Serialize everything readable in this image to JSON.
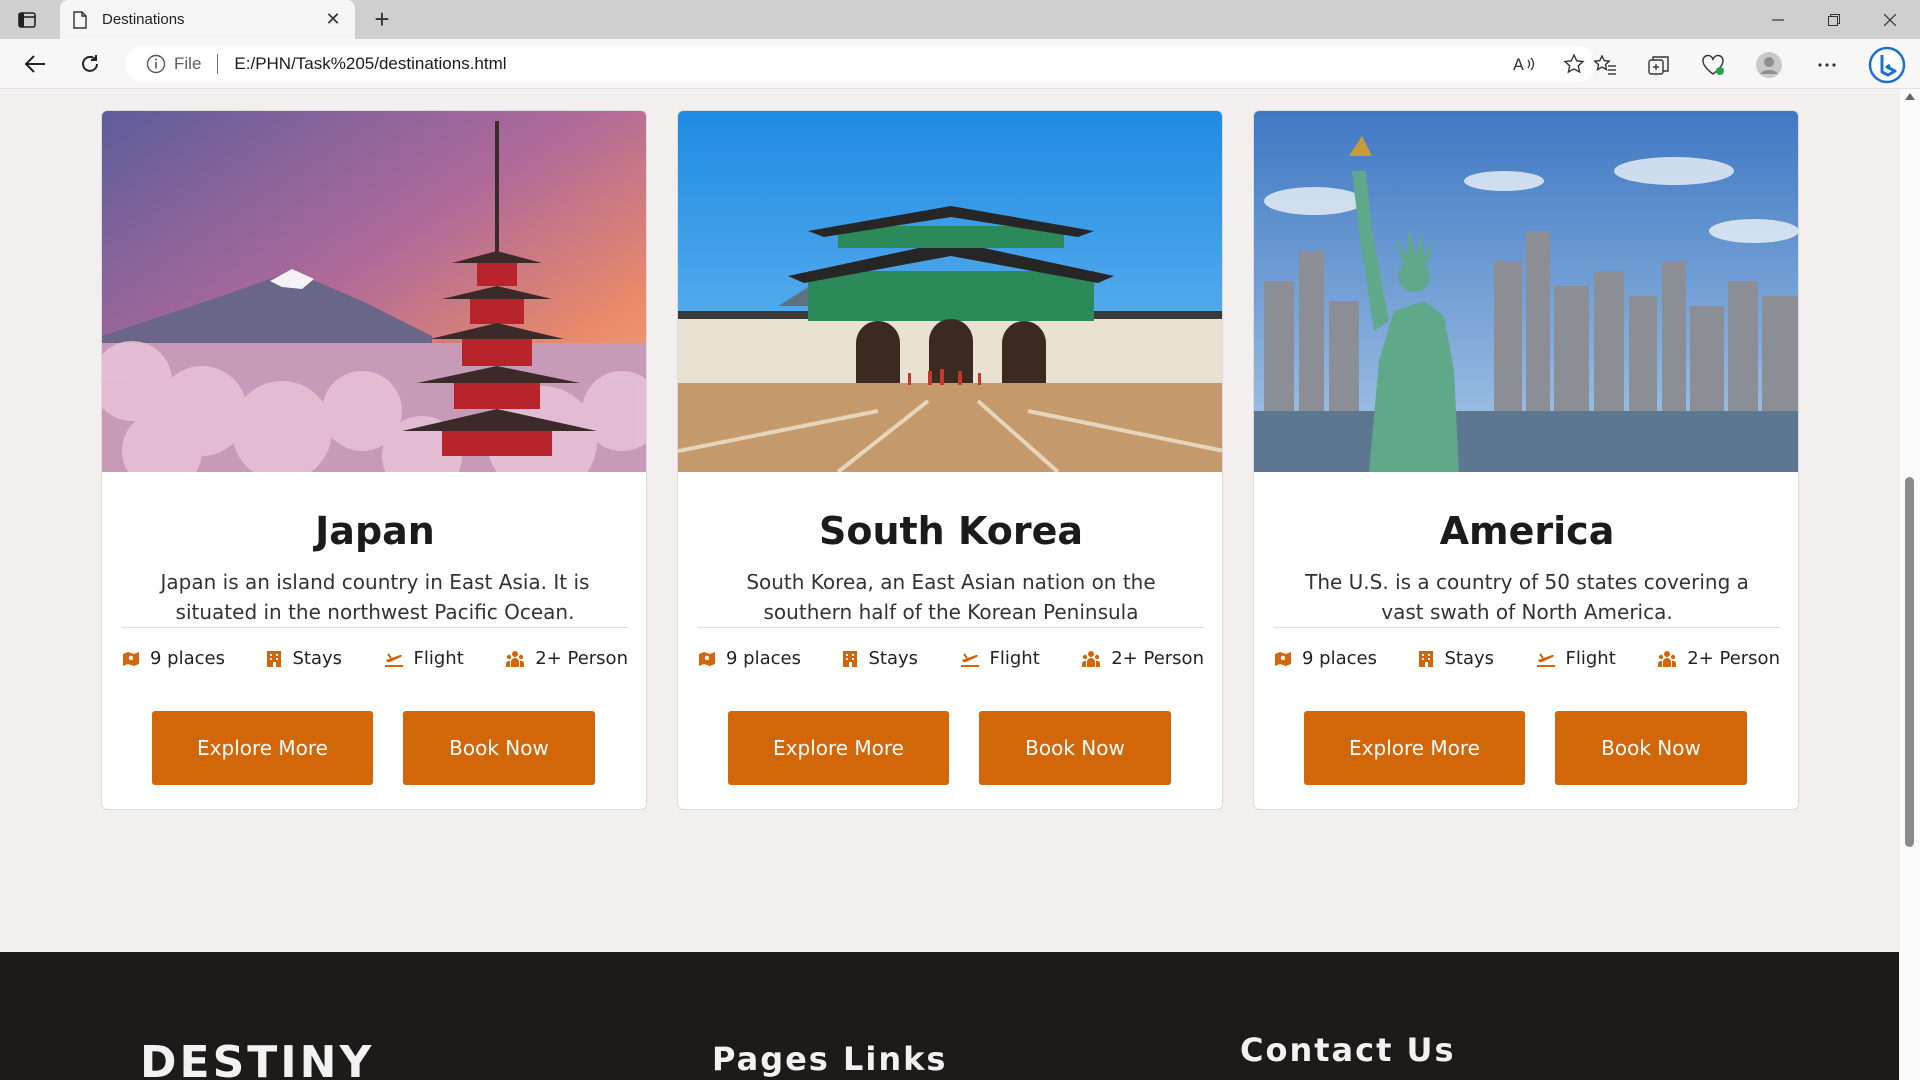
{
  "browser": {
    "tab_title": "Destinations",
    "tab_close": "✕",
    "new_tab": "+",
    "address_scheme": "File",
    "address_url": "E:/PHN/Task%205/destinations.html"
  },
  "colors": {
    "accent": "#d4660a",
    "page_bg": "#f3efef",
    "footer_bg": "#1d1a1a"
  },
  "cards": [
    {
      "title": "Japan",
      "description": "Japan is an island country in East Asia. It is situated in the northwest Pacific Ocean.",
      "features": [
        "9 places",
        "Stays",
        "Flight",
        "2+ Person"
      ],
      "explore_label": "Explore More",
      "book_label": "Book Now"
    },
    {
      "title": "South Korea",
      "description": "South Korea, an East Asian nation on the southern half of the Korean Peninsula",
      "features": [
        "9 places",
        "Stays",
        "Flight",
        "2+ Person"
      ],
      "explore_label": "Explore More",
      "book_label": "Book Now"
    },
    {
      "title": "America",
      "description": "The U.S. is a country of 50 states covering a vast swath of North America.",
      "features": [
        "9 places",
        "Stays",
        "Flight",
        "2+ Person"
      ],
      "explore_label": "Explore More",
      "book_label": "Book Now"
    }
  ],
  "feature_icons": [
    "map-icon",
    "building-icon",
    "plane-icon",
    "people-icon"
  ],
  "footer": {
    "brand": "DESTINY",
    "pages_heading": "Pages Links",
    "contact_heading": "Contact Us"
  }
}
